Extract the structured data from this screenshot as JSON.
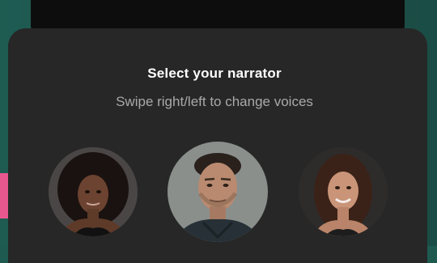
{
  "narrator_picker": {
    "title": "Select your narrator",
    "subtitle": "Swipe right/left to change voices",
    "voices": [
      {
        "icon": "narrator-avatar-female-1"
      },
      {
        "icon": "narrator-avatar-male"
      },
      {
        "icon": "narrator-avatar-female-2"
      }
    ]
  },
  "colors": {
    "background": "#1f5a50",
    "sheet": "#272727",
    "accent": "#e9578f",
    "title": "#ffffff",
    "subtitle": "#a9a9a9"
  }
}
